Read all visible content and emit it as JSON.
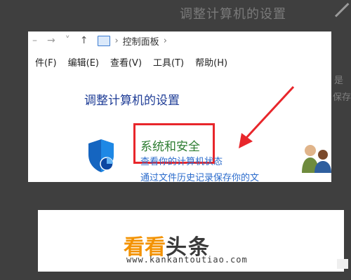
{
  "top_caption": "调整计算机的设置",
  "right_peek": {
    "line1": "是",
    "line2": "保存"
  },
  "window": {
    "breadcrumb": "控制面板",
    "menu": [
      "件(F)",
      "编辑(E)",
      "查看(V)",
      "工具(T)",
      "帮助(H)"
    ],
    "heading": "调整计算机的设置",
    "category": {
      "title": "系统和安全",
      "links": [
        "查看你的计算机状态",
        "通过文件历史记录保存你的文"
      ]
    }
  },
  "banner": {
    "brand_orange": "看看",
    "brand_dark": "头条",
    "url": "www.kankantoutiao.com"
  },
  "colors": {
    "background": "#3f3f3f",
    "heading_blue": "#1e3c96",
    "category_green": "#2e7d32",
    "link_blue": "#2a6bcc",
    "highlight_red": "#e8262b",
    "brand_orange": "#f39200"
  }
}
